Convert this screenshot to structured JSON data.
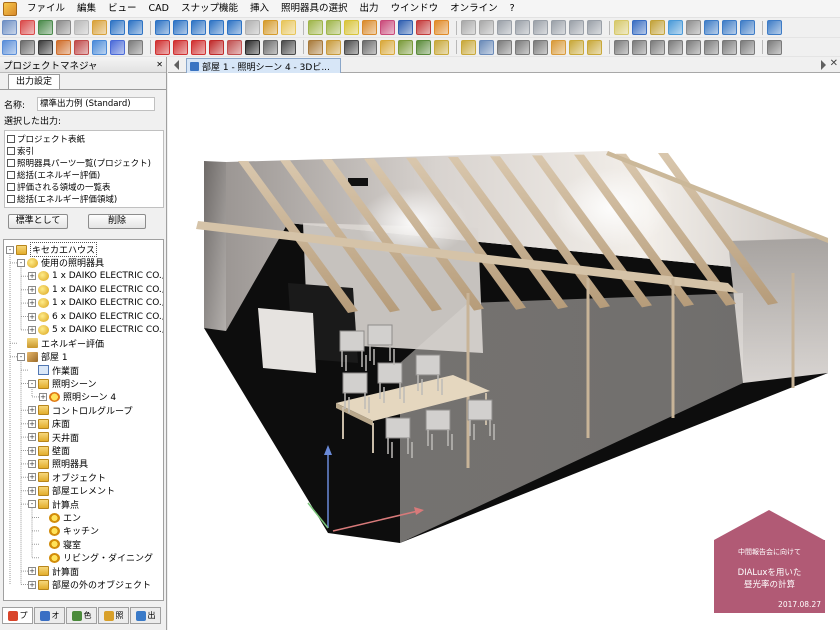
{
  "menu": [
    "ファイル",
    "編集",
    "ビュー",
    "CAD",
    "スナップ機能",
    "挿入",
    "照明器具の選択",
    "出力",
    "ウインドウ",
    "オンライン",
    "?"
  ],
  "toolbar1": [
    "#6e8fc4",
    "#d94a4a",
    "#4b8a4b",
    "#8a8a8a",
    "#b8b8b8",
    "#d8a13a",
    "#2e73c4",
    "#2e73c4",
    "#2e73c4",
    "#2e73c4",
    "#2e73c4",
    "#2e73c4",
    "#2e73c4",
    "#b0b0b0",
    "#d59b2c",
    "#e7c55a",
    "#9fb54a",
    "#9fb54a",
    "#d8c43a",
    "#d98a2c",
    "#c94a7a",
    "#2f5fb0",
    "#c43a3a",
    "#e08a28",
    "#a8a8a8",
    "#a8a8a8",
    "#9aa0a8",
    "#9aa0a8",
    "#9aa0a8",
    "#9aa0a8",
    "#9aa0a8",
    "#9aa0a8",
    "#d6c86a",
    "#3a6ec2",
    "#c2a23a",
    "#4a9ad8",
    "#8e8e8e",
    "#3e7cc6",
    "#3e7cc6",
    "#3e7cc6",
    "#3e7cc6"
  ],
  "toolbar2": [
    "#5a8ed8",
    "#6a6a6a",
    "#3a3a3a",
    "#cf6d2a",
    "#c04a4a",
    "#4a8ad8",
    "#4a6ad8",
    "#7a7a7a",
    "#d03030",
    "#d03030",
    "#d03030",
    "#c02a2a",
    "#c05050",
    "#2a2a2a",
    "#6a6a6a",
    "#4a4a4a",
    "#a87a3a",
    "#c89a3a",
    "#4a4a4a",
    "#6a6a6a",
    "#d8a83a",
    "#7a9a3a",
    "#5a8a3a",
    "#c8a83a",
    "#c8a83a",
    "#6a8ab8",
    "#7a7a7a",
    "#7a7a7a",
    "#7a7a7a",
    "#d89a3a",
    "#c8a83a",
    "#c8a83a",
    "#7a7a7a",
    "#7a7a7a",
    "#7a7a7a",
    "#7a7a7a",
    "#7a7a7a",
    "#7a7a7a",
    "#7a7a7a",
    "#7a7a7a",
    "#7a7a7a"
  ],
  "panel": {
    "title": "プロジェクトマネジャ",
    "tab": "出力設定",
    "name_label": "名称:",
    "name_value": "標準出力例 (Standard)",
    "selected_label": "選択した出力:",
    "outputs": [
      "プロジェクト表紙",
      "索引",
      "照明器具パーツ一覧(プロジェクト)",
      "総括(エネルギー評価)",
      "評価される領域の一覧表",
      "総括(エネルギー評価領域)"
    ],
    "btn_standard": "標準として",
    "btn_delete": "削除"
  },
  "tree": [
    {
      "label": "キセカエハウス",
      "expander": "-",
      "icon": "i-folder",
      "selected": true
    },
    {
      "label": "使用の照明器具",
      "expander": "-",
      "icon": "i-lamp"
    },
    {
      "label": "1 x DAIKO ELECTRIC CO.,LT",
      "expander": "+",
      "icon": "i-lamp"
    },
    {
      "label": "1 x DAIKO ELECTRIC CO.,LT",
      "expander": "+",
      "icon": "i-lamp"
    },
    {
      "label": "1 x DAIKO ELECTRIC CO.,LT",
      "expander": "+",
      "icon": "i-lamp"
    },
    {
      "label": "6 x DAIKO ELECTRIC CO.,LT",
      "expander": "+",
      "icon": "i-lamp"
    },
    {
      "label": "5 x DAIKO ELECTRIC CO.,LT",
      "expander": "+",
      "icon": "i-lamp"
    },
    {
      "label": "エネルギー評価",
      "expander": "",
      "icon": "i-energy"
    },
    {
      "label": "部屋 1",
      "expander": "-",
      "icon": "i-room"
    },
    {
      "label": "作業面",
      "expander": "",
      "icon": "i-plane"
    },
    {
      "label": "照明シーン",
      "expander": "-",
      "icon": "i-folder"
    },
    {
      "label": "照明シーン 4",
      "expander": "+",
      "icon": "i-scene"
    },
    {
      "label": "コントロルグループ",
      "expander": "+",
      "icon": "i-folder"
    },
    {
      "label": "床面",
      "expander": "+",
      "icon": "i-folder"
    },
    {
      "label": "天井面",
      "expander": "+",
      "icon": "i-folder"
    },
    {
      "label": "壁面",
      "expander": "+",
      "icon": "i-folder"
    },
    {
      "label": "照明器具",
      "expander": "+",
      "icon": "i-folder"
    },
    {
      "label": "オブジェクト",
      "expander": "+",
      "icon": "i-folder"
    },
    {
      "label": "部屋エレメント",
      "expander": "+",
      "icon": "i-folder"
    },
    {
      "label": "計算点",
      "expander": "-",
      "icon": "i-folder"
    },
    {
      "label": "エン",
      "expander": "",
      "icon": "i-point"
    },
    {
      "label": "キッチン",
      "expander": "",
      "icon": "i-point"
    },
    {
      "label": "寝室",
      "expander": "",
      "icon": "i-point"
    },
    {
      "label": "リビング・ダイニング",
      "expander": "",
      "icon": "i-point"
    },
    {
      "label": "計算面",
      "expander": "+",
      "icon": "i-folder"
    },
    {
      "label": "部屋の外のオブジェクト",
      "expander": "+",
      "icon": "i-folder"
    }
  ],
  "bottom_tabs": [
    {
      "label": "プ",
      "color": "#d9452b"
    },
    {
      "label": "オ",
      "color": "#3a6fc4"
    },
    {
      "label": "色",
      "color": "#4a8a3a"
    },
    {
      "label": "照",
      "color": "#d8a02a"
    },
    {
      "label": "出",
      "color": "#3a7ac8"
    }
  ],
  "document_tab": "部屋 1 - 照明シーン 4 - 3Dビ...",
  "badge": {
    "subtitle": "中間報告会に向けて",
    "title_line1": "DIALuxを用いた",
    "title_line2": "昼光率の計算",
    "date": "2017.08.27"
  }
}
